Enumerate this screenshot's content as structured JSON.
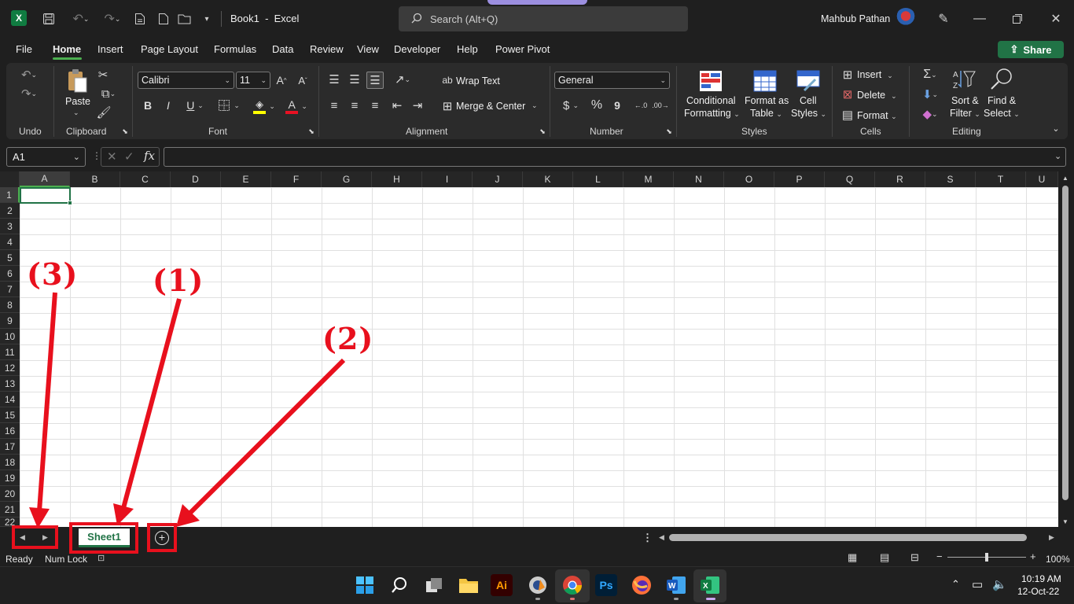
{
  "titlebar": {
    "doc_title": "Book1  -  Excel",
    "search_placeholder": "Search (Alt+Q)",
    "user_name": "Mahbub Pathan",
    "icons": [
      "excel-app-icon",
      "save-icon",
      "undo-icon",
      "redo-icon",
      "new-from-template-icon",
      "new-file-icon",
      "open-folder-icon",
      "customize-qat-icon",
      "pen-icon",
      "minimize-icon",
      "maximize-icon",
      "close-icon"
    ]
  },
  "menu": {
    "tabs": [
      "File",
      "Home",
      "Insert",
      "Page Layout",
      "Formulas",
      "Data",
      "Review",
      "View",
      "Developer",
      "Help",
      "Power Pivot"
    ],
    "active_tab": "Home",
    "share_label": "Share"
  },
  "ribbon": {
    "groups": {
      "undo": "Undo",
      "clipboard": "Clipboard",
      "font": "Font",
      "alignment": "Alignment",
      "number": "Number",
      "styles": "Styles",
      "cells": "Cells",
      "editing": "Editing"
    },
    "paste_label": "Paste",
    "font_name": "Calibri",
    "font_size": "11",
    "bold": "B",
    "italic": "I",
    "underline": "U",
    "wrap_text": "Wrap Text",
    "merge_center": "Merge & Center",
    "number_format": "General",
    "currency_symbol": "$",
    "percent_symbol": "%",
    "comma_symbol": "9",
    "conditional_formatting": [
      "Conditional",
      "Formatting"
    ],
    "format_as_table": [
      "Format as",
      "Table"
    ],
    "cell_styles": [
      "Cell",
      "Styles"
    ],
    "insert": "Insert",
    "delete": "Delete",
    "format": "Format",
    "sort_filter": [
      "Sort &",
      "Filter"
    ],
    "find_select": [
      "Find &",
      "Select"
    ]
  },
  "formula_bar": {
    "name_box": "A1",
    "fx_label": "fx",
    "formula": ""
  },
  "grid": {
    "columns": [
      "A",
      "B",
      "C",
      "D",
      "E",
      "F",
      "G",
      "H",
      "I",
      "J",
      "K",
      "L",
      "M",
      "N",
      "O",
      "P",
      "Q",
      "R",
      "S",
      "T",
      "U"
    ],
    "rows": [
      "1",
      "2",
      "3",
      "4",
      "5",
      "6",
      "7",
      "8",
      "9",
      "10",
      "11",
      "12",
      "13",
      "14",
      "15",
      "16",
      "17",
      "18",
      "19",
      "20",
      "21",
      "22"
    ],
    "active_cell": "A1"
  },
  "sheets": {
    "tabs": [
      "Sheet1"
    ],
    "active": "Sheet1"
  },
  "statusbar": {
    "ready": "Ready",
    "num_lock": "Num Lock",
    "zoom": "100%"
  },
  "taskbar": {
    "time": "10:19 AM",
    "date": "12-Oct-22",
    "apps": [
      "windows-start",
      "search",
      "task-view",
      "file-explorer",
      "illustrator",
      "vlc-or-tool",
      "chrome",
      "photoshop",
      "firefox",
      "word",
      "excel"
    ]
  },
  "annotations": {
    "label_1": "(1)",
    "label_2": "(2)",
    "label_3": "(3)"
  },
  "colors": {
    "excel_green": "#217346",
    "annotation_red": "#e8101d",
    "accent_purple": "#9c8fe0"
  }
}
